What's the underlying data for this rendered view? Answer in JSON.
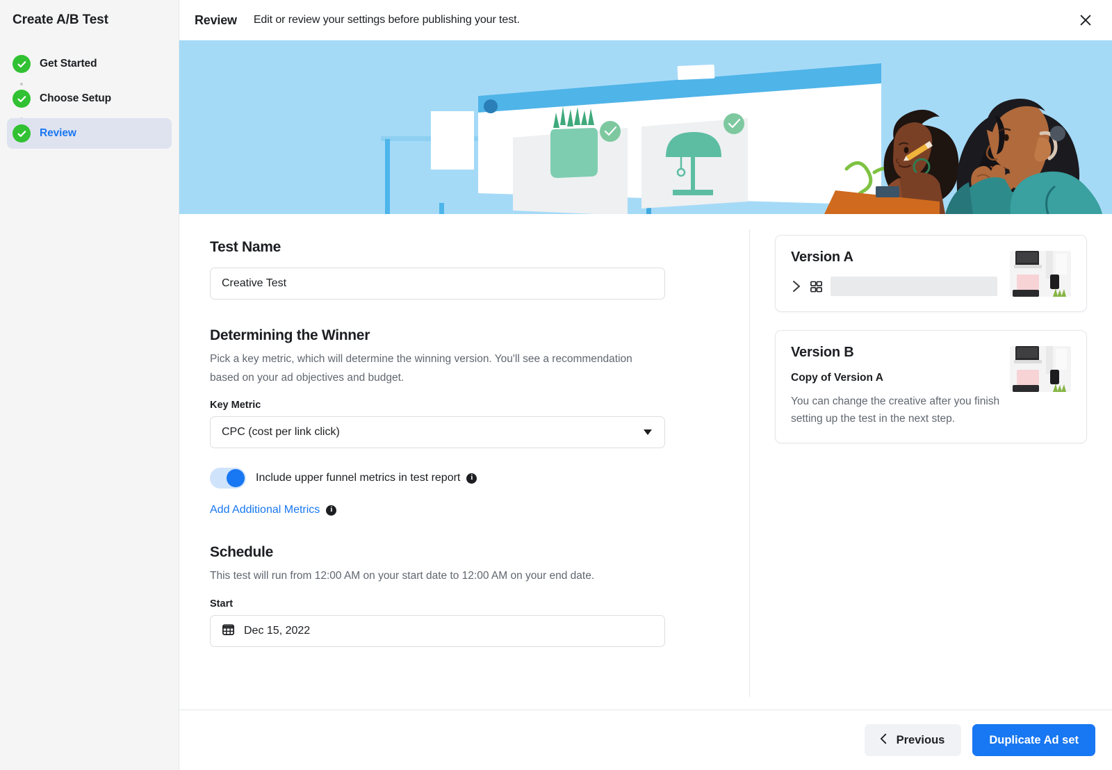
{
  "sidebar": {
    "title": "Create A/B Test",
    "steps": [
      {
        "label": "Get Started",
        "state": "complete"
      },
      {
        "label": "Choose Setup",
        "state": "complete"
      },
      {
        "label": "Review",
        "state": "active"
      }
    ]
  },
  "header": {
    "title": "Review",
    "subtitle": "Edit or review your settings before publishing your test.",
    "close_icon": "close-icon"
  },
  "hero": {
    "alt": "Two people reviewing two creative options on a board",
    "bg_color": "#a5daf7",
    "accent_color": "#3fa9e0",
    "check_color": "#7ec8a0"
  },
  "form": {
    "test_name": {
      "heading": "Test Name",
      "value": "Creative Test",
      "placeholder": "Test name"
    },
    "winner": {
      "heading": "Determining the Winner",
      "description": "Pick a key metric, which will determine the winning version. You'll see a recommendation based on your ad objectives and budget.",
      "key_metric_label": "Key Metric",
      "key_metric_value": "CPC (cost per link click)",
      "key_metric_options": [
        "CPC (cost per link click)"
      ],
      "toggle_label": "Include upper funnel metrics in test report",
      "toggle_on": true,
      "add_metrics_link": "Add Additional Metrics"
    },
    "schedule": {
      "heading": "Schedule",
      "description": "This test will run from 12:00 AM on your start date to 12:00 AM on your end date.",
      "start_label": "Start",
      "start_value": "Dec 15, 2022"
    }
  },
  "versions": [
    {
      "title": "Version A",
      "redacted": true,
      "sub": "",
      "text": ""
    },
    {
      "title": "Version B",
      "redacted": false,
      "sub": "Copy of Version A",
      "text": "You can change the creative after you finish setting up the test in the next step."
    }
  ],
  "footer": {
    "previous_label": "Previous",
    "primary_label": "Duplicate Ad set"
  },
  "colors": {
    "accent_blue": "#1877f2",
    "green_check": "#31c132",
    "active_step_bg": "#dfe3f0",
    "hero_blue": "#a5daf7"
  }
}
